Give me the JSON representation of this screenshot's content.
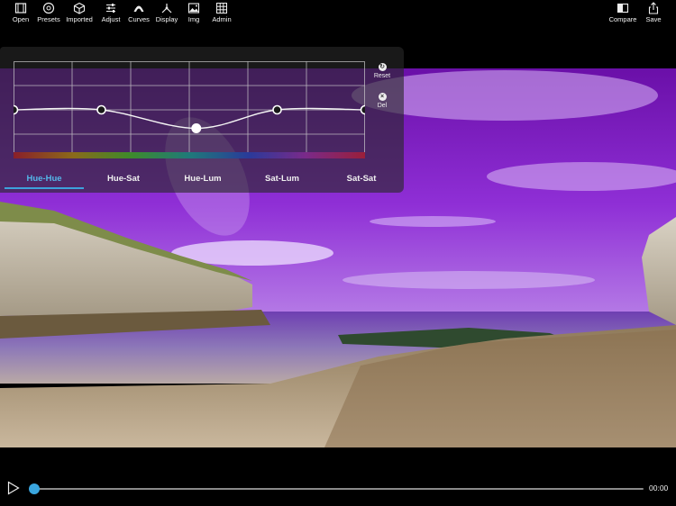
{
  "toolbar": {
    "left_items": [
      {
        "label": "Open",
        "icon": "film-icon"
      },
      {
        "label": "Presets",
        "icon": "presets-icon"
      },
      {
        "label": "Imported",
        "icon": "cube-icon"
      },
      {
        "label": "Adjust",
        "icon": "sliders-icon"
      },
      {
        "label": "Curves",
        "icon": "curves-icon"
      },
      {
        "label": "Display",
        "icon": "display-icon"
      },
      {
        "label": "Img",
        "icon": "image-icon"
      },
      {
        "label": "Admin",
        "icon": "grid-icon"
      }
    ],
    "right_items": [
      {
        "label": "Compare",
        "icon": "compare-icon"
      },
      {
        "label": "Save",
        "icon": "share-icon"
      }
    ]
  },
  "curves_panel": {
    "reset_label": "Reset",
    "delete_label": "Del",
    "control_points": [
      {
        "hue": 0.0,
        "value": 0.5
      },
      {
        "hue": 0.25,
        "value": 0.5
      },
      {
        "hue": 0.52,
        "value": 0.31
      },
      {
        "hue": 0.75,
        "value": 0.5
      },
      {
        "hue": 1.0,
        "value": 0.5
      }
    ],
    "selected_point": 2,
    "tabs": [
      "Hue-Hue",
      "Hue-Sat",
      "Hue-Lum",
      "Sat-Lum",
      "Sat-Sat"
    ],
    "active_tab": "Hue-Hue",
    "accent_color": "#3da2dc"
  },
  "player": {
    "time": "00:00",
    "progress": 0.0
  }
}
